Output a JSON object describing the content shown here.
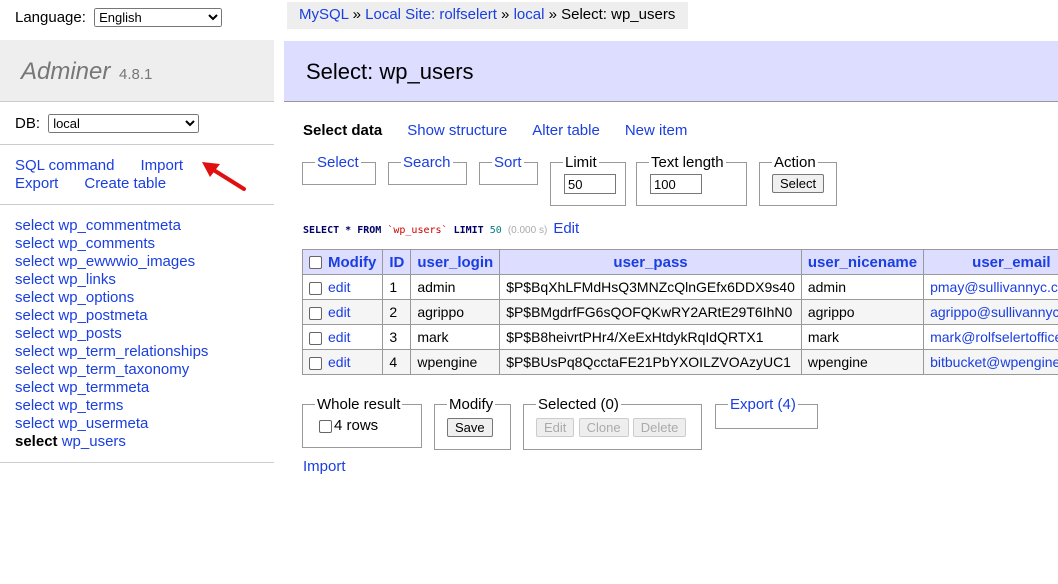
{
  "language": {
    "label": "Language:",
    "selected": "English"
  },
  "brand": {
    "name": "Adminer",
    "version": "4.8.1"
  },
  "db": {
    "label": "DB:",
    "selected": "local"
  },
  "commands": {
    "sql": "SQL command",
    "import": "Import",
    "export": "Export",
    "create_table": "Create table"
  },
  "tables": [
    {
      "prefix": "select",
      "name": "wp_commentmeta"
    },
    {
      "prefix": "select",
      "name": "wp_comments"
    },
    {
      "prefix": "select",
      "name": "wp_ewwwio_images"
    },
    {
      "prefix": "select",
      "name": "wp_links"
    },
    {
      "prefix": "select",
      "name": "wp_options"
    },
    {
      "prefix": "select",
      "name": "wp_postmeta"
    },
    {
      "prefix": "select",
      "name": "wp_posts"
    },
    {
      "prefix": "select",
      "name": "wp_term_relationships"
    },
    {
      "prefix": "select",
      "name": "wp_term_taxonomy"
    },
    {
      "prefix": "select",
      "name": "wp_termmeta"
    },
    {
      "prefix": "select",
      "name": "wp_terms"
    },
    {
      "prefix": "select",
      "name": "wp_usermeta"
    },
    {
      "prefix": "select",
      "name": "wp_users"
    }
  ],
  "breadcrumb": {
    "mysql": "MySQL",
    "sep": "»",
    "site": "Local Site: rolfselert",
    "db": "local",
    "current": "Select: wp_users"
  },
  "page_title": "Select: wp_users",
  "tabs": {
    "select_data": "Select data",
    "show_structure": "Show structure",
    "alter_table": "Alter table",
    "new_item": "New item"
  },
  "filters": {
    "select": "Select",
    "search": "Search",
    "sort": "Sort",
    "limit": {
      "label": "Limit",
      "value": "50"
    },
    "text_length": {
      "label": "Text length",
      "value": "100"
    },
    "action": {
      "label": "Action",
      "button": "Select"
    }
  },
  "query": {
    "select": "SELECT",
    "star": "*",
    "from": "FROM",
    "table": "`wp_users`",
    "limit": "LIMIT",
    "limit_value": "50",
    "time": "(0.000 s)",
    "edit": "Edit"
  },
  "grid": {
    "headers": {
      "modify": "Modify",
      "id": "ID",
      "user_login": "user_login",
      "user_pass": "user_pass",
      "user_nicename": "user_nicename",
      "user_email": "user_email"
    },
    "edit_label": "edit",
    "rows": [
      {
        "id": "1",
        "login": "admin",
        "pass": "$P$BqXhLFMdHsQ3MNZcQlnGEfx6DDX9s40",
        "nicename": "admin",
        "email": "pmay@sullivannyc.com"
      },
      {
        "id": "2",
        "login": "agrippo",
        "pass": "$P$BMgdrfFG6sQOFQKwRY2ARtE29T6IhN0",
        "nicename": "agrippo",
        "email": "agrippo@sullivannyc.com"
      },
      {
        "id": "3",
        "login": "mark",
        "pass": "$P$B8heivrtPHr4/XeExHtdykRqIdQRTX1",
        "nicename": "mark",
        "email": "mark@rolfselertoffice.com"
      },
      {
        "id": "4",
        "login": "wpengine",
        "pass": "$P$BUsPq8QcctaFE21PbYXOILZVOAzyUC1",
        "nicename": "wpengine",
        "email": "bitbucket@wpengine.com"
      }
    ]
  },
  "bottom": {
    "whole_result": {
      "label": "Whole result",
      "rows": "4 rows"
    },
    "modify": {
      "label": "Modify",
      "save": "Save"
    },
    "selected": {
      "label": "Selected (0)",
      "edit": "Edit",
      "clone": "Clone",
      "delete": "Delete"
    },
    "export": "Export (4)",
    "import": "Import"
  },
  "colors": {
    "accent": "#1a3ee0",
    "header_bg": "#ddf",
    "arrow": "#e01010"
  }
}
